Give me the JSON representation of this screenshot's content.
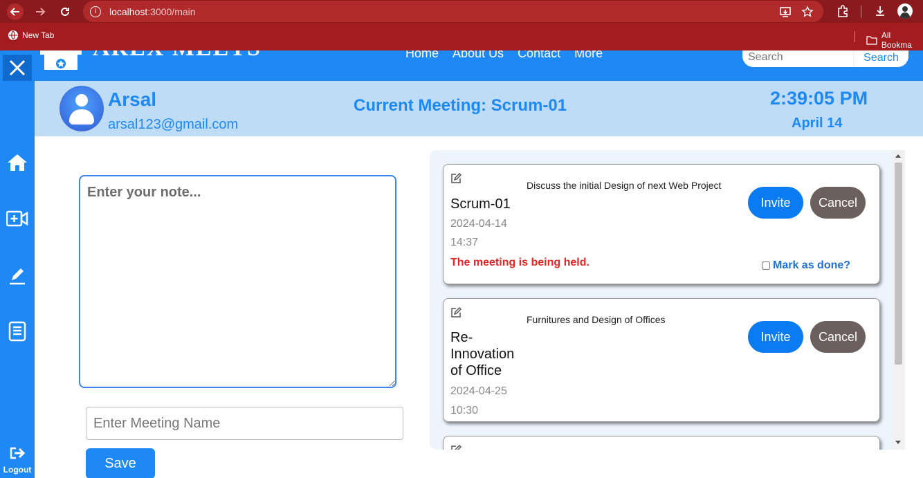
{
  "browser": {
    "url_host": "localhost",
    "url_path": ":3000/main",
    "bookmarks": [
      "New Tab",
      "All Bookma"
    ]
  },
  "header": {
    "logo_text": "AREX MEETS",
    "nav": [
      "Home",
      "About Us",
      "Contact",
      "More"
    ],
    "search_placeholder": "Search",
    "search_button": "Search"
  },
  "sidebar": {
    "logout_label": "Logout"
  },
  "user": {
    "name": "Arsal",
    "email": "arsal123@gmail.com"
  },
  "current_meeting": "Current Meeting: Scrum-01",
  "clock": {
    "time": "2:39:05 PM",
    "date": "April 14"
  },
  "notes": {
    "note_placeholder": "Enter your note...",
    "meeting_name_placeholder": "Enter Meeting Name",
    "save_label": "Save"
  },
  "meetings": [
    {
      "title": "Scrum-01",
      "date": "2024-04-14",
      "time": "14:37",
      "description": "Discuss the initial Design of next Web Project",
      "status": "The meeting is being held.",
      "mark_done_label": "Mark as done?",
      "invite_label": "Invite",
      "cancel_label": "Cancel"
    },
    {
      "title_lines": [
        "Re-",
        "Innovation",
        "of Office"
      ],
      "date": "2024-04-25",
      "time": "10:30",
      "description": "Furnitures and Design of Offices",
      "invite_label": "Invite",
      "cancel_label": "Cancel"
    }
  ],
  "colors": {
    "browser_bar": "#8b1a1e",
    "bookmark_bar": "#a51c20",
    "primary": "#1e88f5",
    "userbar": "#bfdcf7",
    "cancel": "#6b605d",
    "status": "#e62622"
  }
}
